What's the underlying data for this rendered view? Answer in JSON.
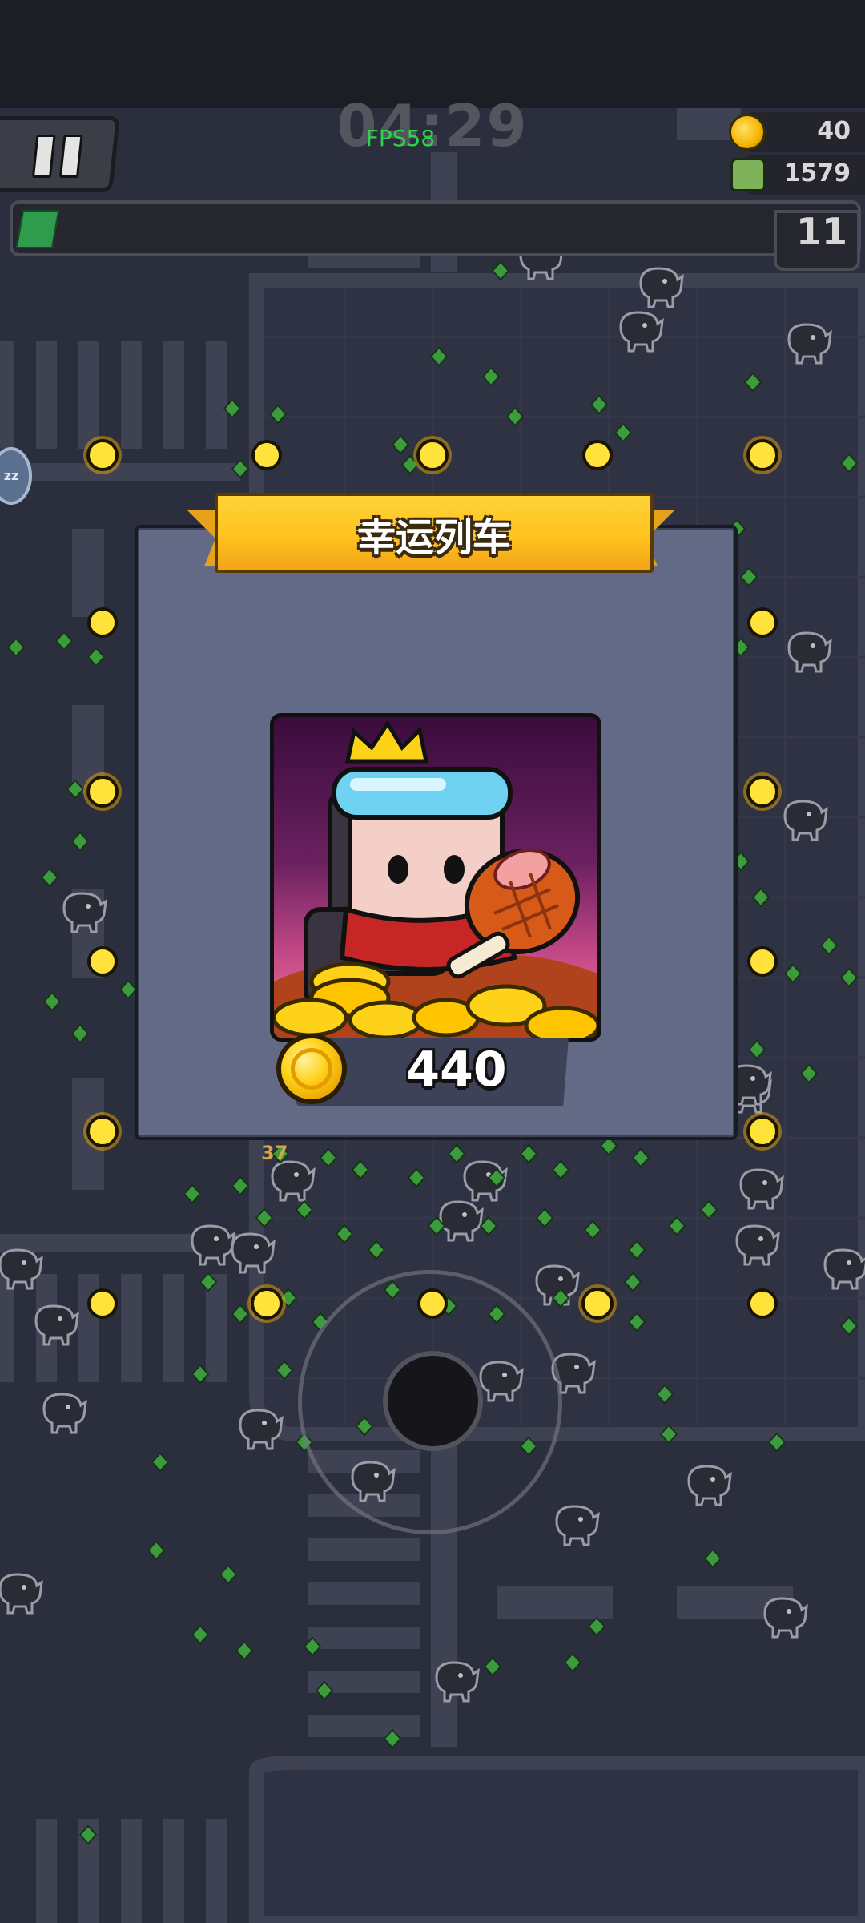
{
  "hud": {
    "timer": "04:29",
    "fps": "FPS58",
    "coins": "40",
    "kills": "1579",
    "level": "11",
    "xp_progress": 0.04,
    "icons": {
      "pause": "pause-icon",
      "coin": "coin-icon",
      "kill": "skull-icon",
      "sleep": "zz-icon"
    },
    "sleep_label": "zz"
  },
  "popup": {
    "title": "幸运列车",
    "price": "440",
    "image": "character-with-crown-holding-meat-on-gold-coins"
  },
  "floating_damage": "37",
  "colors": {
    "ground": "#2b2e3c",
    "road_marking": "#3f4252",
    "gem": "#3a9a3a",
    "coin": "#ffd21a",
    "ribbon": "#ffc21d",
    "modal": "#626a86",
    "fps": "#2fd24a"
  }
}
